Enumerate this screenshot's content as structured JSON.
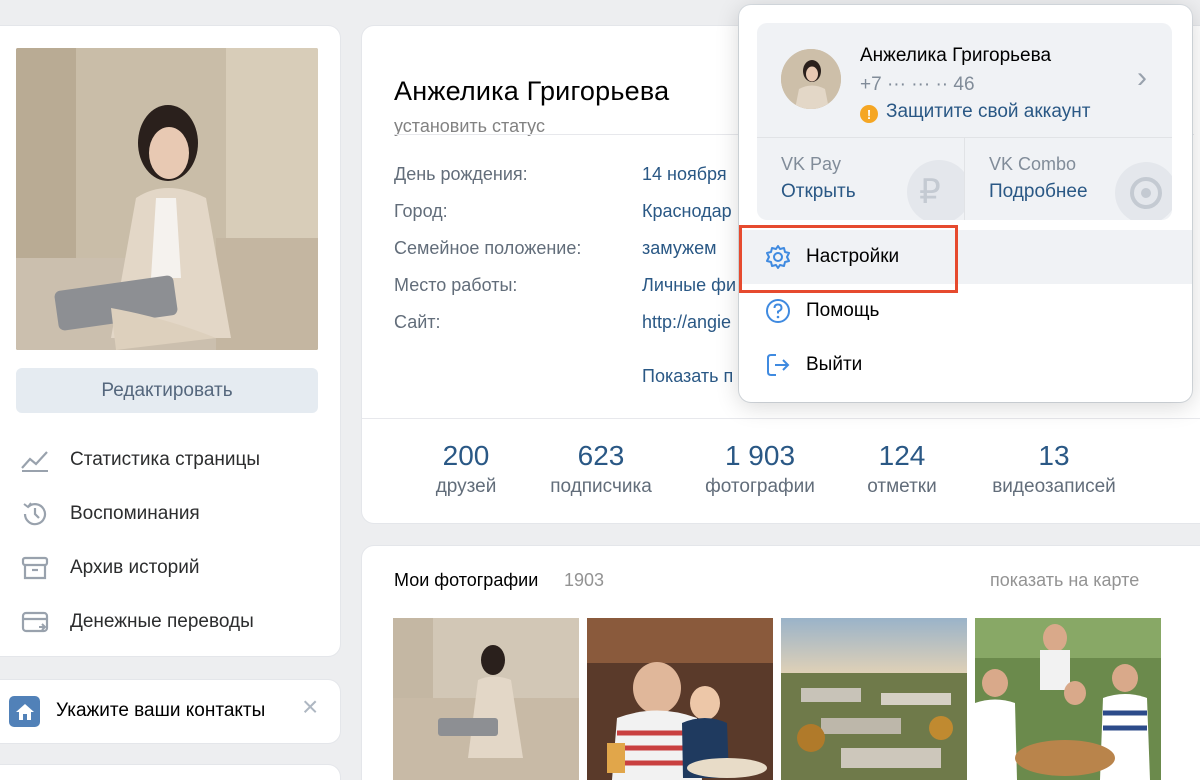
{
  "profile": {
    "name": "Анжелика Григорьева",
    "status_placeholder": "установить статус",
    "edit_button": "Редактировать",
    "info": [
      {
        "label": "День рождения:",
        "value": "14 ноября"
      },
      {
        "label": "Город:",
        "value": "Краснодар"
      },
      {
        "label": "Семейное положение:",
        "value": "замужем"
      },
      {
        "label": "Место работы:",
        "value": "Личные фи"
      },
      {
        "label": "Сайт:",
        "value": "http://angie"
      }
    ],
    "show_more": "Показать п",
    "counters": [
      {
        "value": "200",
        "label": "друзей"
      },
      {
        "value": "623",
        "label": "подписчика"
      },
      {
        "value": "1 903",
        "label": "фотографии"
      },
      {
        "value": "124",
        "label": "отметки"
      },
      {
        "value": "13",
        "label": "видеозаписей"
      }
    ]
  },
  "sidebar": {
    "items": [
      {
        "label": "Статистика страницы",
        "icon": "stats-chart-icon"
      },
      {
        "label": "Воспоминания",
        "icon": "history-clock-icon"
      },
      {
        "label": "Архив историй",
        "icon": "archive-box-icon"
      },
      {
        "label": "Денежные переводы",
        "icon": "money-transfer-icon"
      }
    ]
  },
  "contacts_banner": {
    "text": "Укажите ваши контакты",
    "icon": "home-icon",
    "close": "×"
  },
  "photos": {
    "title": "Мои фотографии",
    "count": "1903",
    "map_link": "показать на карте"
  },
  "dropdown": {
    "account": {
      "name": "Анжелика Григорьева",
      "phone": "+7 ··· ··· ·· 46",
      "protect": "Защитите свой аккаунт",
      "chevron": "›"
    },
    "vkpay": {
      "title": "VK Pay",
      "action": "Открыть",
      "icon_glyph": "₽"
    },
    "vkcombo": {
      "title": "VK Combo",
      "action": "Подробнее"
    },
    "menu": [
      {
        "label": "Настройки",
        "icon": "gear-icon",
        "highlighted": true
      },
      {
        "label": "Помощь",
        "icon": "help-question-icon",
        "highlighted": false
      },
      {
        "label": "Выйти",
        "icon": "logout-icon",
        "highlighted": false
      }
    ]
  },
  "colors": {
    "accent": "#2a5885",
    "highlight_border": "#e64a2e",
    "warning": "#f5a623",
    "background": "#edeef0"
  }
}
